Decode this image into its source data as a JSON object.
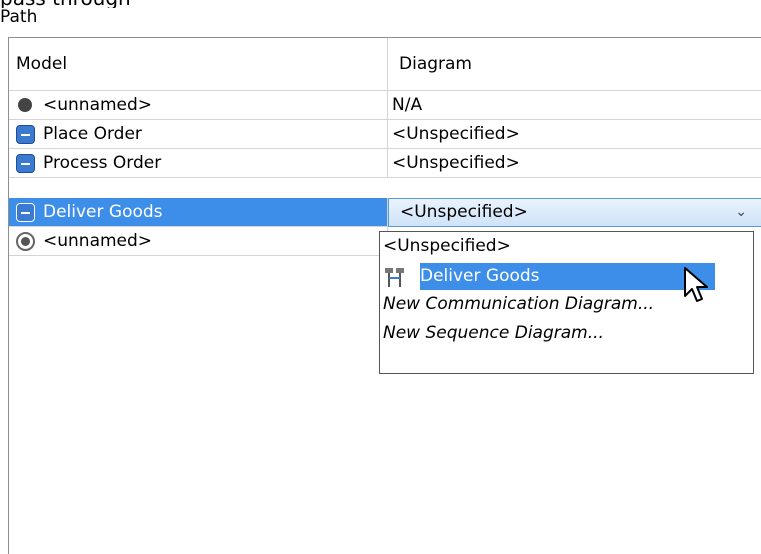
{
  "top_partial_text": "pass through",
  "path_label": "Path",
  "columns": {
    "model": "Model",
    "diagram": "Diagram"
  },
  "rows": [
    {
      "icon": "initial-node-icon",
      "model": "<unnamed>",
      "diagram": "N/A"
    },
    {
      "icon": "action-icon",
      "model": "Place Order",
      "diagram": "<Unspecified>"
    },
    {
      "icon": "action-icon",
      "model": "Process Order",
      "diagram": "<Unspecified>"
    },
    {
      "icon": "action-icon",
      "model": "Deliver Goods",
      "diagram": "<Unspecified>",
      "selected": true
    },
    {
      "icon": "final-node-icon",
      "model": "<unnamed>",
      "diagram": ""
    }
  ],
  "dropdown": {
    "selected_value": "<Unspecified>",
    "options": [
      {
        "label": "<Unspecified>"
      },
      {
        "label": "Deliver Goods",
        "icon": "interaction-diagram-icon",
        "highlighted": true
      },
      {
        "label": "New Communication Diagram...",
        "italic": true
      },
      {
        "label": "New Sequence Diagram...",
        "italic": true
      }
    ]
  },
  "colors": {
    "selection": "#3d8ee8",
    "grid": "#d5d5d5"
  }
}
